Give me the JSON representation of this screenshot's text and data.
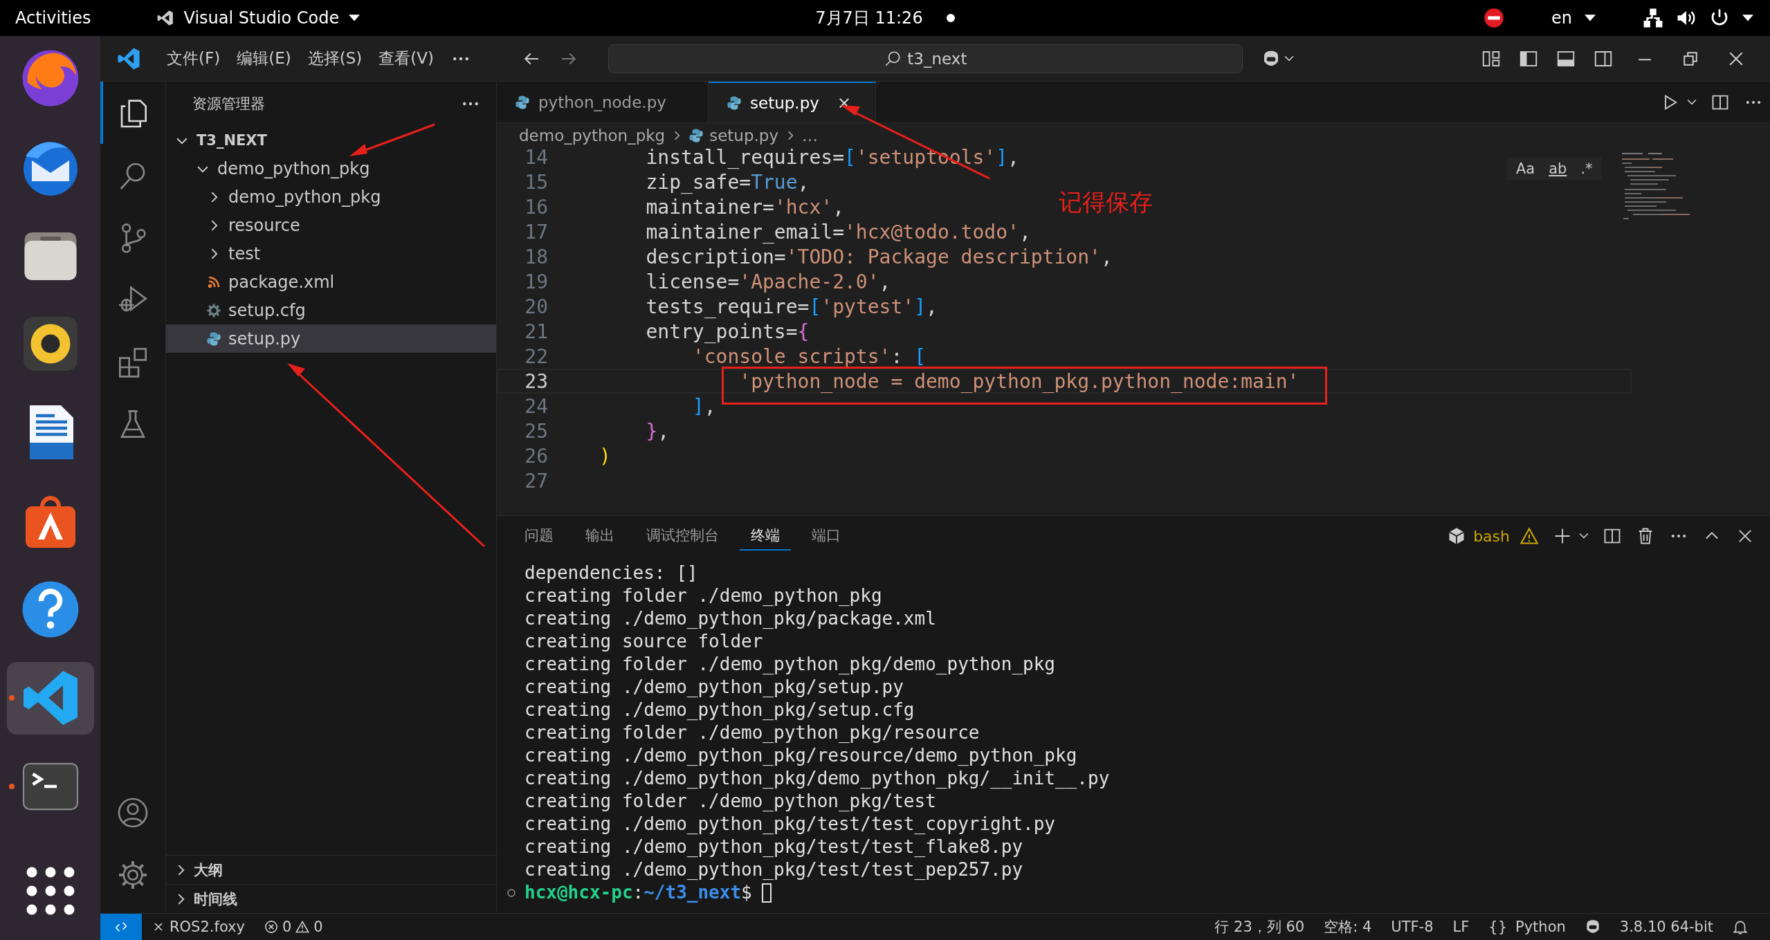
{
  "top_bar": {
    "activities": "Activities",
    "app_name": "Visual Studio Code",
    "clock": "7月7日  11:26",
    "language": "en"
  },
  "dock": {
    "apps": [
      {
        "kind": "browser",
        "running": false,
        "selected": false
      },
      {
        "kind": "mail",
        "running": false,
        "selected": false
      },
      {
        "kind": "files",
        "running": false,
        "selected": false
      },
      {
        "kind": "music",
        "running": false,
        "selected": false
      },
      {
        "kind": "writer",
        "running": false,
        "selected": false
      },
      {
        "kind": "store",
        "running": false,
        "selected": false
      },
      {
        "kind": "help",
        "running": false,
        "selected": false
      },
      {
        "kind": "code",
        "running": true,
        "selected": true
      },
      {
        "kind": "terminal",
        "running": true,
        "selected": false
      },
      {
        "kind": "grid",
        "running": false,
        "selected": false
      }
    ]
  },
  "title_bar": {
    "menus": [
      "文件(F)",
      "编辑(E)",
      "选择(S)",
      "查看(V)"
    ],
    "search": "t3_next"
  },
  "activity_bar": {
    "items": [
      {
        "kind": "explorer",
        "selected": true
      },
      {
        "kind": "search",
        "selected": false
      },
      {
        "kind": "source",
        "selected": false
      },
      {
        "kind": "debug",
        "selected": false
      },
      {
        "kind": "extensions",
        "selected": false
      },
      {
        "kind": "testing",
        "selected": false
      }
    ]
  },
  "explorer": {
    "title": "资源管理器",
    "root": {
      "label": "T3_NEXT",
      "expanded": true,
      "children": [
        {
          "label": "demo_python_pkg",
          "kind": "folder",
          "expanded": true,
          "selected": false,
          "children": [
            {
              "label": "demo_python_pkg",
              "kind": "folder",
              "expanded": false,
              "selected": false
            },
            {
              "label": "resource",
              "kind": "folder",
              "expanded": false,
              "selected": false
            },
            {
              "label": "test",
              "kind": "folder",
              "expanded": false,
              "selected": false
            },
            {
              "label": "package.xml",
              "kind": "xml",
              "selected": false
            },
            {
              "label": "setup.cfg",
              "kind": "config",
              "selected": false
            },
            {
              "label": "setup.py",
              "kind": "python",
              "selected": true
            }
          ]
        }
      ]
    },
    "sections": [
      {
        "label": "大纲",
        "expanded": false
      },
      {
        "label": "时间线",
        "expanded": false
      }
    ]
  },
  "editor": {
    "tabs": [
      {
        "label": "python_node.py",
        "selected": false
      },
      {
        "label": "setup.py",
        "selected": true
      }
    ],
    "breadcrumb": [
      "demo_python_pkg",
      "setup.py",
      "…"
    ],
    "find_options": [
      "Aa",
      "ab",
      ".*"
    ],
    "lines": [
      {
        "number": "14",
        "current": false,
        "boxed": false,
        "tokens": [
          {
            "t": "    install_requires=",
            "kind": "text"
          },
          {
            "t": "[",
            "kind": "bracket"
          },
          {
            "t": "'setuptools'",
            "kind": "string"
          },
          {
            "t": "]",
            "kind": "bracket"
          },
          {
            "t": ",",
            "kind": "text"
          }
        ]
      },
      {
        "number": "15",
        "current": false,
        "boxed": false,
        "tokens": [
          {
            "t": "    zip_safe=",
            "kind": "text"
          },
          {
            "t": "True",
            "kind": "constant"
          },
          {
            "t": ",",
            "kind": "text"
          }
        ]
      },
      {
        "number": "16",
        "current": false,
        "boxed": false,
        "tokens": [
          {
            "t": "    maintainer=",
            "kind": "text"
          },
          {
            "t": "'hcx'",
            "kind": "string"
          },
          {
            "t": ",",
            "kind": "text"
          }
        ]
      },
      {
        "number": "17",
        "current": false,
        "boxed": false,
        "tokens": [
          {
            "t": "    maintainer_email=",
            "kind": "text"
          },
          {
            "t": "'hcx@todo.todo'",
            "kind": "string"
          },
          {
            "t": ",",
            "kind": "text"
          }
        ]
      },
      {
        "number": "18",
        "current": false,
        "boxed": false,
        "tokens": [
          {
            "t": "    description=",
            "kind": "text"
          },
          {
            "t": "'TODO: Package description'",
            "kind": "string"
          },
          {
            "t": ",",
            "kind": "text"
          }
        ]
      },
      {
        "number": "19",
        "current": false,
        "boxed": false,
        "tokens": [
          {
            "t": "    license=",
            "kind": "text"
          },
          {
            "t": "'Apache-2.0'",
            "kind": "string"
          },
          {
            "t": ",",
            "kind": "text"
          }
        ]
      },
      {
        "number": "20",
        "current": false,
        "boxed": false,
        "tokens": [
          {
            "t": "    tests_require=",
            "kind": "text"
          },
          {
            "t": "[",
            "kind": "bracket"
          },
          {
            "t": "'pytest'",
            "kind": "string"
          },
          {
            "t": "]",
            "kind": "bracket"
          },
          {
            "t": ",",
            "kind": "text"
          }
        ]
      },
      {
        "number": "21",
        "current": false,
        "boxed": false,
        "tokens": [
          {
            "t": "    entry_points=",
            "kind": "text"
          },
          {
            "t": "{",
            "kind": "brace"
          }
        ]
      },
      {
        "number": "22",
        "current": false,
        "boxed": false,
        "tokens": [
          {
            "t": "        'console_scripts'",
            "kind": "string"
          },
          {
            "t": ": ",
            "kind": "text"
          },
          {
            "t": "[",
            "kind": "bracket"
          }
        ]
      },
      {
        "number": "23",
        "current": true,
        "boxed": true,
        "tokens": [
          {
            "t": "            'python_node = demo_python_pkg.python_node:main'",
            "kind": "string"
          }
        ]
      },
      {
        "number": "24",
        "current": false,
        "boxed": false,
        "tokens": [
          {
            "t": "        ]",
            "kind": "bracket"
          },
          {
            "t": ",",
            "kind": "text"
          }
        ]
      },
      {
        "number": "25",
        "current": false,
        "boxed": false,
        "tokens": [
          {
            "t": "    }",
            "kind": "brace"
          },
          {
            "t": ",",
            "kind": "text"
          }
        ]
      },
      {
        "number": "26",
        "current": false,
        "boxed": false,
        "tokens": [
          {
            "t": ")",
            "kind": "paren"
          }
        ]
      },
      {
        "number": "27",
        "current": false
      }
    ]
  },
  "panel": {
    "tabs": [
      {
        "label": "问题",
        "selected": false
      },
      {
        "label": "输出",
        "selected": false
      },
      {
        "label": "调试控制台",
        "selected": false
      },
      {
        "label": "终端",
        "selected": true
      },
      {
        "label": "端口",
        "selected": false
      }
    ],
    "shell": "bash",
    "terminal_lines": [
      "dependencies: []",
      "creating folder ./demo_python_pkg",
      "creating ./demo_python_pkg/package.xml",
      "creating source folder",
      "creating folder ./demo_python_pkg/demo_python_pkg",
      "creating ./demo_python_pkg/setup.py",
      "creating ./demo_python_pkg/setup.cfg",
      "creating folder ./demo_python_pkg/resource",
      "creating ./demo_python_pkg/resource/demo_python_pkg",
      "creating ./demo_python_pkg/demo_python_pkg/__init__.py",
      "creating folder ./demo_python_pkg/test",
      "creating ./demo_python_pkg/test/test_copyright.py",
      "creating ./demo_python_pkg/test/test_flake8.py",
      "creating ./demo_python_pkg/test/test_pep257.py"
    ],
    "prompt": {
      "user": "hcx@hcx-pc",
      "separator": ":",
      "path": "~/t3_next",
      "symbol": "$"
    }
  },
  "status_bar": {
    "remote_name": "ROS2.foxy",
    "errors": "0",
    "warnings": "0",
    "position": "行 23，列 60",
    "indent": "空格: 4",
    "encoding": "UTF-8",
    "eol": "LF",
    "braces": "{}",
    "language": "Python",
    "interpreter": "3.8.10 64-bit"
  },
  "annotation": {
    "note": "记得保存"
  }
}
